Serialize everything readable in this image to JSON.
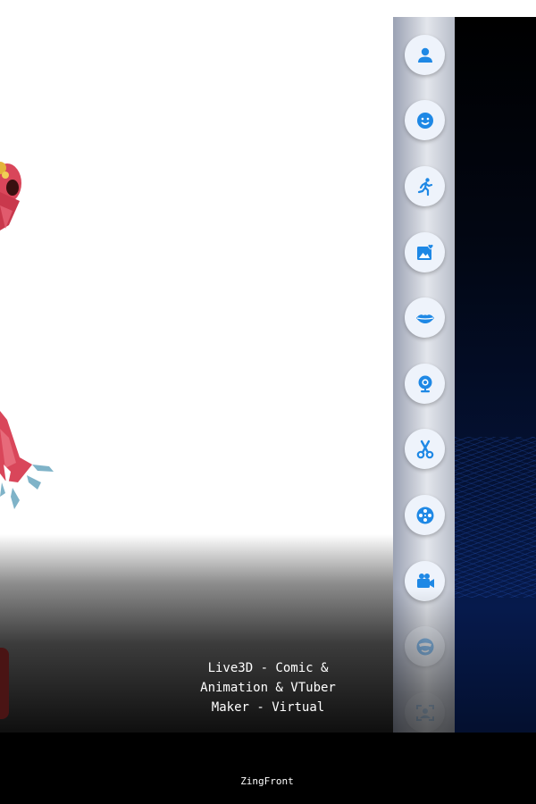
{
  "caption": {
    "title": "Live3D - Comic &\nAnimation & VTuber\nMaker - Virtual"
  },
  "footer": {
    "brand": "ZingFront"
  },
  "sidebar": {
    "buttons": [
      {
        "name": "avatar-button",
        "icon": "person-icon"
      },
      {
        "name": "face-button",
        "icon": "smiley-face-icon"
      },
      {
        "name": "motion-button",
        "icon": "running-person-icon"
      },
      {
        "name": "background-image-button",
        "icon": "image-heart-icon"
      },
      {
        "name": "lip-sync-button",
        "icon": "lips-icon"
      },
      {
        "name": "webcam-button",
        "icon": "webcam-icon"
      },
      {
        "name": "edit-button",
        "icon": "scissors-icon"
      },
      {
        "name": "film-button",
        "icon": "film-reel-icon"
      },
      {
        "name": "record-button",
        "icon": "video-camera-icon"
      },
      {
        "name": "mask-button",
        "icon": "masked-face-icon"
      },
      {
        "name": "capture-button",
        "icon": "screen-capture-icon"
      }
    ]
  },
  "colors": {
    "icon_blue": "#1e88e5",
    "button_bg": "#eef3fb",
    "footer_bg": "#000000",
    "character_red": "#d9465a"
  }
}
